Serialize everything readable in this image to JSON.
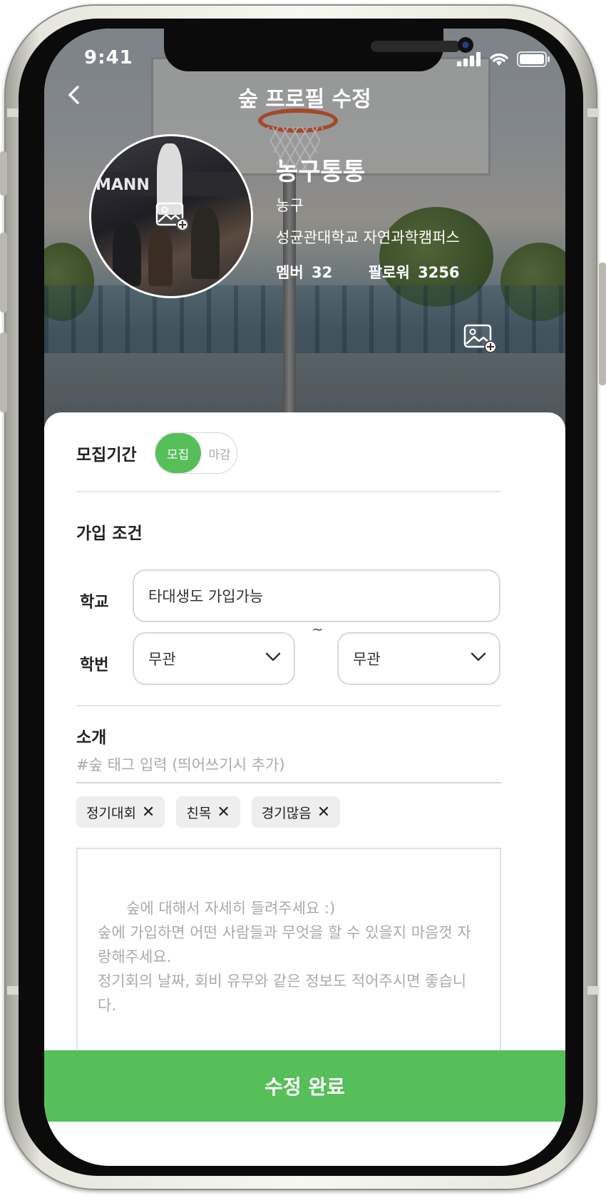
{
  "status_bar": {
    "time": "9:41"
  },
  "header": {
    "title": "숲 프로필 수정"
  },
  "club": {
    "name": "농구통통",
    "sport": "농구",
    "school": "성균관대학교 자연과학캠퍼스",
    "members_label": "멤버",
    "members_count": "32",
    "followers_label": "팔로워",
    "followers_count": "3256",
    "photo_banner_text": "MANN"
  },
  "form": {
    "recruit_label": "모집기간",
    "recruit_toggle": {
      "on_label": "모집",
      "off_label": "마감",
      "selected": "모집"
    },
    "join_condition_title": "가입 조건",
    "school_label": "학교",
    "school_value": "타대생도 가입가능",
    "student_id_label": "학번",
    "student_id_from": "무관",
    "student_id_to": "무관",
    "range_separator": "~",
    "intro_title": "소개",
    "tag_placeholder": "#숲 태그 입력 (띄어쓰기시 추가)",
    "tags": [
      {
        "label": "정기대회"
      },
      {
        "label": "친목"
      },
      {
        "label": "경기많음"
      }
    ],
    "tag_remove_symbol": "✕",
    "description_placeholder": "숲에 대해서 자세히 들려주세요 :)\n숲에 가입하면 어떤 사람들과 무엇을 할 수 있을지 마음껏 자랑해주세요.\n정기회의 날짜, 회비 유무와 같은 정보도 적어주시면 좋습니다."
  },
  "submit_label": "수정 완료",
  "colors": {
    "accent": "#56bf5a"
  },
  "icons": [
    "back-arrow-icon",
    "signal-icon",
    "wifi-icon",
    "battery-icon",
    "add-photo-icon",
    "chevron-down-icon",
    "close-icon"
  ]
}
